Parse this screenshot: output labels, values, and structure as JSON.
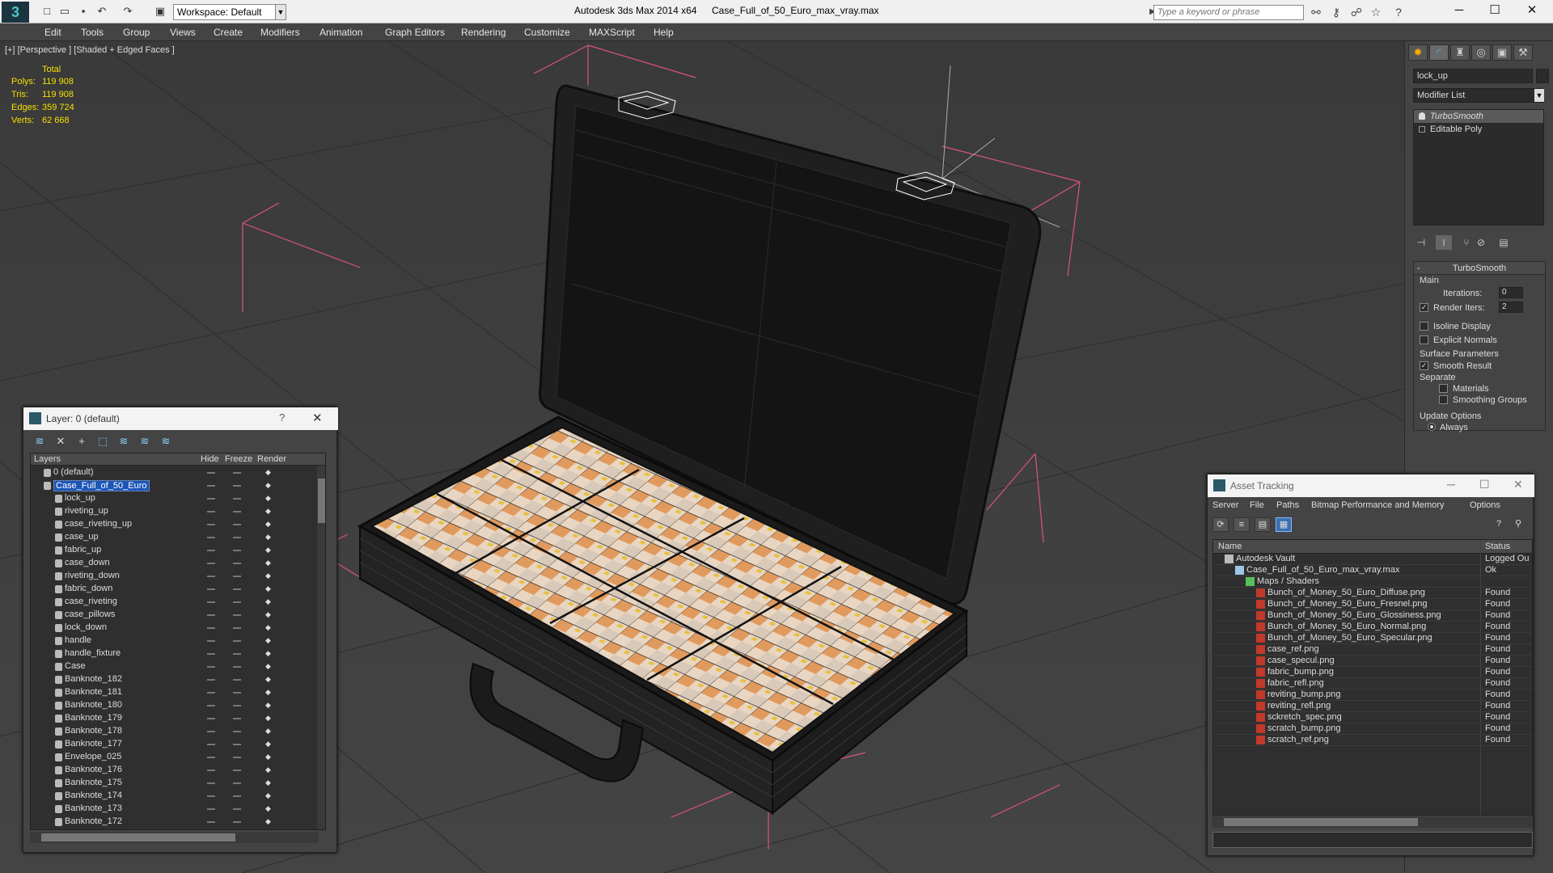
{
  "titlebar": {
    "workspace_label": "Workspace: Default",
    "app_title": "Autodesk 3ds Max 2014 x64",
    "file_name": "Case_Full_of_50_Euro_max_vray.max",
    "search_placeholder": "Type a keyword or phrase"
  },
  "menu": [
    "Edit",
    "Tools",
    "Group",
    "Views",
    "Create",
    "Modifiers",
    "Animation",
    "Graph Editors",
    "Rendering",
    "Customize",
    "MAXScript",
    "Help"
  ],
  "viewport": {
    "label": "[+] [Perspective ] [Shaded + Edged Faces ]",
    "stats_header": "Total",
    "stats": [
      {
        "label": "Polys:",
        "value": "119 908"
      },
      {
        "label": "Tris:",
        "value": "119 908"
      },
      {
        "label": "Edges:",
        "value": "359 724"
      },
      {
        "label": "Verts:",
        "value": "62 668"
      }
    ]
  },
  "command_panel": {
    "object_name": "lock_up",
    "modifier_list": "Modifier List",
    "stack": [
      "TurboSmooth",
      "Editable Poly"
    ],
    "rollout_title": "TurboSmooth",
    "main_label": "Main",
    "iterations_label": "Iterations:",
    "iterations_value": "0",
    "render_iters_label": "Render Iters:",
    "render_iters_value": "2",
    "isoline_label": "Isoline Display",
    "explicit_normals_label": "Explicit Normals",
    "surface_params_label": "Surface Parameters",
    "smooth_result_label": "Smooth Result",
    "separate_label": "Separate",
    "materials_label": "Materials",
    "smoothing_groups_label": "Smoothing Groups",
    "update_options_label": "Update Options",
    "always_label": "Always"
  },
  "layer_dialog": {
    "title": "Layer: 0 (default)",
    "help": "?",
    "columns": {
      "layers": "Layers",
      "hide": "Hide",
      "freeze": "Freeze",
      "render": "Render"
    },
    "rows": [
      {
        "name": "0 (default)",
        "indent": 0,
        "type": "layer"
      },
      {
        "name": "Case_Full_of_50_Euro",
        "indent": 0,
        "type": "layer",
        "selected": true
      },
      {
        "name": "lock_up",
        "indent": 1,
        "type": "object"
      },
      {
        "name": "riveting_up",
        "indent": 1,
        "type": "object"
      },
      {
        "name": "case_riveting_up",
        "indent": 1,
        "type": "object"
      },
      {
        "name": "case_up",
        "indent": 1,
        "type": "object"
      },
      {
        "name": "fabric_up",
        "indent": 1,
        "type": "object"
      },
      {
        "name": "case_down",
        "indent": 1,
        "type": "object"
      },
      {
        "name": "riveting_down",
        "indent": 1,
        "type": "object"
      },
      {
        "name": "fabric_down",
        "indent": 1,
        "type": "object"
      },
      {
        "name": "case_riveting",
        "indent": 1,
        "type": "object"
      },
      {
        "name": "case_pillows",
        "indent": 1,
        "type": "object"
      },
      {
        "name": "lock_down",
        "indent": 1,
        "type": "object"
      },
      {
        "name": "handle",
        "indent": 1,
        "type": "object"
      },
      {
        "name": "handle_fixture",
        "indent": 1,
        "type": "object"
      },
      {
        "name": "Case",
        "indent": 1,
        "type": "object"
      },
      {
        "name": "Banknote_182",
        "indent": 1,
        "type": "object"
      },
      {
        "name": "Banknote_181",
        "indent": 1,
        "type": "object"
      },
      {
        "name": "Banknote_180",
        "indent": 1,
        "type": "object"
      },
      {
        "name": "Banknote_179",
        "indent": 1,
        "type": "object"
      },
      {
        "name": "Banknote_178",
        "indent": 1,
        "type": "object"
      },
      {
        "name": "Banknote_177",
        "indent": 1,
        "type": "object"
      },
      {
        "name": "Envelope_025",
        "indent": 1,
        "type": "object"
      },
      {
        "name": "Banknote_176",
        "indent": 1,
        "type": "object"
      },
      {
        "name": "Banknote_175",
        "indent": 1,
        "type": "object"
      },
      {
        "name": "Banknote_174",
        "indent": 1,
        "type": "object"
      },
      {
        "name": "Banknote_173",
        "indent": 1,
        "type": "object"
      },
      {
        "name": "Banknote_172",
        "indent": 1,
        "type": "object"
      }
    ]
  },
  "asset_dialog": {
    "title": "Asset Tracking",
    "menu": [
      "Server",
      "File",
      "Paths",
      "Bitmap Performance and Memory",
      "Options"
    ],
    "columns": {
      "name": "Name",
      "status": "Status"
    },
    "rows": [
      {
        "name": "Autodesk Vault",
        "indent": 0,
        "status": "Logged Ou",
        "icon": "vault"
      },
      {
        "name": "Case_Full_of_50_Euro_max_vray.max",
        "indent": 1,
        "status": "Ok",
        "icon": "max"
      },
      {
        "name": "Maps / Shaders",
        "indent": 2,
        "status": "",
        "icon": "folder"
      },
      {
        "name": "Bunch_of_Money_50_Euro_Diffuse.png",
        "indent": 3,
        "status": "Found",
        "icon": "png"
      },
      {
        "name": "Bunch_of_Money_50_Euro_Fresnel.png",
        "indent": 3,
        "status": "Found",
        "icon": "png"
      },
      {
        "name": "Bunch_of_Money_50_Euro_Glossiness.png",
        "indent": 3,
        "status": "Found",
        "icon": "png"
      },
      {
        "name": "Bunch_of_Money_50_Euro_Normal.png",
        "indent": 3,
        "status": "Found",
        "icon": "png"
      },
      {
        "name": "Bunch_of_Money_50_Euro_Specular.png",
        "indent": 3,
        "status": "Found",
        "icon": "png"
      },
      {
        "name": "case_ref.png",
        "indent": 3,
        "status": "Found",
        "icon": "png"
      },
      {
        "name": "case_specul.png",
        "indent": 3,
        "status": "Found",
        "icon": "png"
      },
      {
        "name": "fabric_bump.png",
        "indent": 3,
        "status": "Found",
        "icon": "png"
      },
      {
        "name": "fabric_refl.png",
        "indent": 3,
        "status": "Found",
        "icon": "png"
      },
      {
        "name": "reviting_bump.png",
        "indent": 3,
        "status": "Found",
        "icon": "png"
      },
      {
        "name": "reviting_refl.png",
        "indent": 3,
        "status": "Found",
        "icon": "png"
      },
      {
        "name": "sckretch_spec.png",
        "indent": 3,
        "status": "Found",
        "icon": "png"
      },
      {
        "name": "scratch_bump.png",
        "indent": 3,
        "status": "Found",
        "icon": "png"
      },
      {
        "name": "scratch_ref.png",
        "indent": 3,
        "status": "Found",
        "icon": "png"
      }
    ]
  },
  "colors": {
    "accent_selection": "#1d56b8",
    "stats_yellow": "#f5e000",
    "png_icon": "#c0392b",
    "bbox_pink": "#d9557a"
  }
}
